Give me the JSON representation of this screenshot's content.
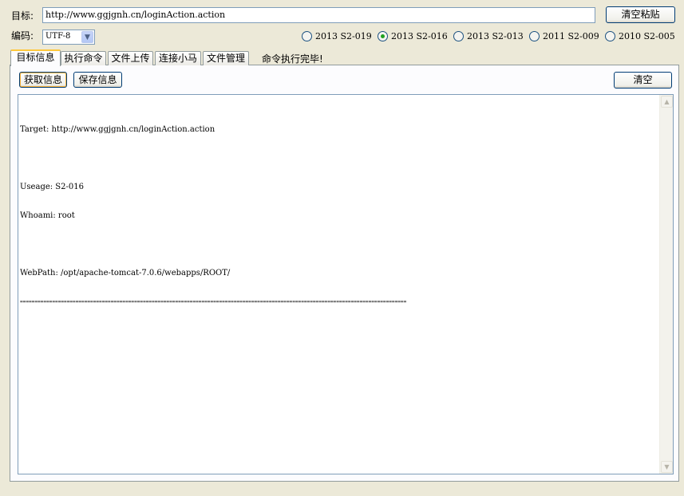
{
  "target": {
    "label": "目标:",
    "value": "http://www.ggjgnh.cn/loginAction.action"
  },
  "paste_button": "清空粘贴",
  "encoding": {
    "label": "编码:",
    "selected": "UTF-8",
    "dropdown_icon": "chevron-down-icon"
  },
  "exploits": [
    {
      "label": "2013 S2-019",
      "selected": false
    },
    {
      "label": "2013 S2-016",
      "selected": true
    },
    {
      "label": "2013 S2-013",
      "selected": false
    },
    {
      "label": "2011 S2-009",
      "selected": false
    },
    {
      "label": "2010 S2-005",
      "selected": false
    }
  ],
  "tabs": [
    {
      "label": "目标信息",
      "active": true
    },
    {
      "label": "执行命令",
      "active": false
    },
    {
      "label": "文件上传",
      "active": false
    },
    {
      "label": "连接小马",
      "active": false
    },
    {
      "label": "文件管理",
      "active": false
    }
  ],
  "status": "命令执行完毕!",
  "toolbar": {
    "get_info": "获取信息",
    "save_info": "保存信息",
    "clear": "清空"
  },
  "output": {
    "lines": [
      "Target: http://www.ggjgnh.cn/loginAction.action",
      "",
      "Useage: S2-016",
      "Whoami: root",
      "",
      "WebPath: /opt/apache-tomcat-7.0.6/webapps/ROOT/",
      "===================================================================================================================================="
    ]
  },
  "colors": {
    "window_bg": "#ece9d8",
    "tab_highlight": "#ffc83c",
    "radio_dot": "#21a121"
  }
}
